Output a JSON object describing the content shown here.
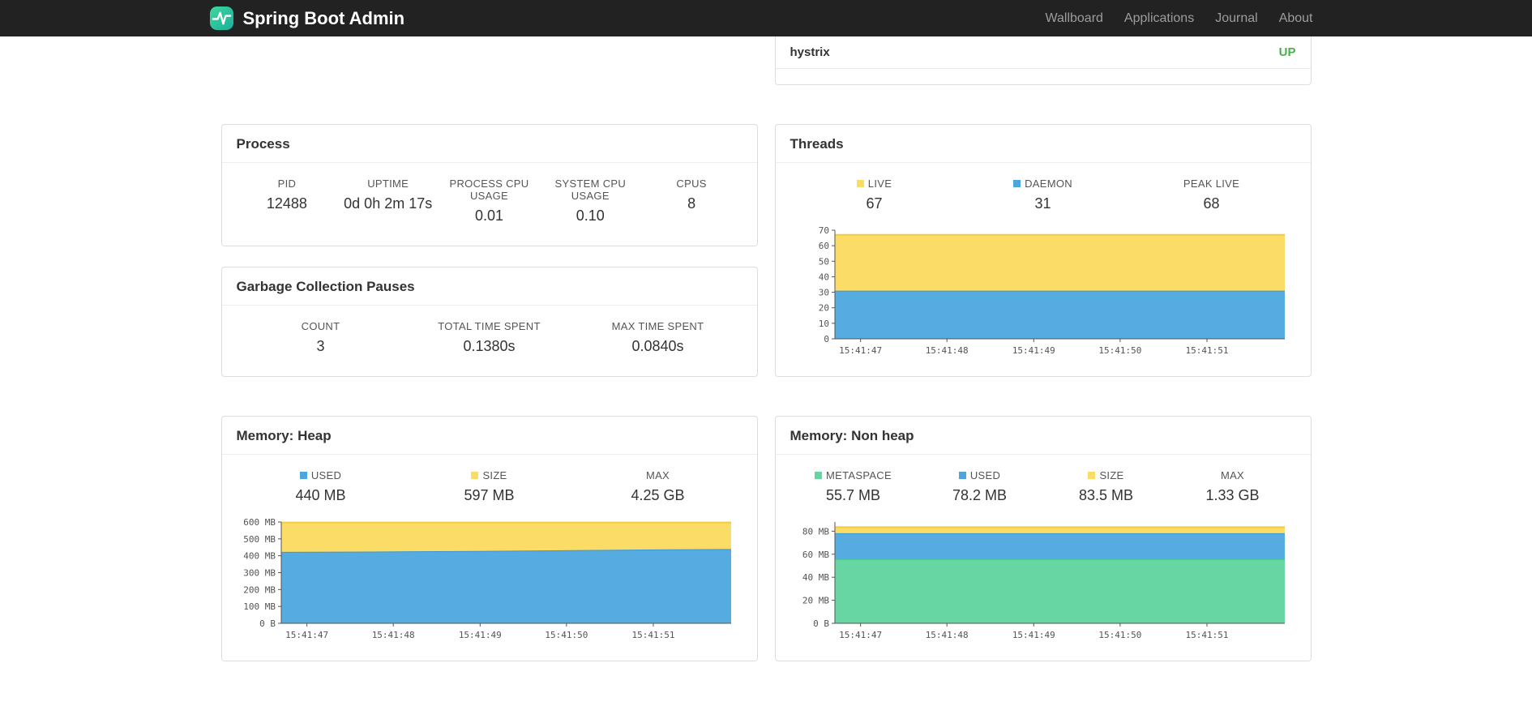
{
  "navbar": {
    "brand": "Spring Boot Admin",
    "items": [
      {
        "label": "Wallboard"
      },
      {
        "label": "Applications"
      },
      {
        "label": "Journal"
      },
      {
        "label": "About"
      }
    ]
  },
  "applications": {
    "rows": [
      {
        "name": "hystrix",
        "status": "UP",
        "status_color": "#47B04B"
      }
    ]
  },
  "process": {
    "title": "Process",
    "stats": [
      {
        "label": "PID",
        "value": "12488"
      },
      {
        "label": "UPTIME",
        "value": "0d 0h 2m 17s"
      },
      {
        "label": "PROCESS CPU USAGE",
        "value": "0.01"
      },
      {
        "label": "SYSTEM CPU USAGE",
        "value": "0.10"
      },
      {
        "label": "CPUS",
        "value": "8"
      }
    ]
  },
  "gc": {
    "title": "Garbage Collection Pauses",
    "stats": [
      {
        "label": "COUNT",
        "value": "3"
      },
      {
        "label": "TOTAL TIME SPENT",
        "value": "0.1380s"
      },
      {
        "label": "MAX TIME SPENT",
        "value": "0.0840s"
      }
    ]
  },
  "threads": {
    "title": "Threads",
    "stats": [
      {
        "label": "LIVE",
        "value": "67",
        "swatch": "#FBDC66"
      },
      {
        "label": "DAEMON",
        "value": "31",
        "swatch": "#4DA5DC"
      },
      {
        "label": "PEAK LIVE",
        "value": "68"
      }
    ]
  },
  "heap": {
    "title": "Memory: Heap",
    "stats": [
      {
        "label": "USED",
        "value": "440 MB",
        "swatch": "#4DA5DC"
      },
      {
        "label": "SIZE",
        "value": "597 MB",
        "swatch": "#FBDC66"
      },
      {
        "label": "MAX",
        "value": "4.25 GB"
      }
    ]
  },
  "nonheap": {
    "title": "Memory: Non heap",
    "stats": [
      {
        "label": "METASPACE",
        "value": "55.7 MB",
        "swatch": "#63D5A0"
      },
      {
        "label": "USED",
        "value": "78.2 MB",
        "swatch": "#4DA5DC"
      },
      {
        "label": "SIZE",
        "value": "83.5 MB",
        "swatch": "#FBDC66"
      },
      {
        "label": "MAX",
        "value": "1.33 GB"
      }
    ]
  },
  "chart_data": [
    {
      "id": "threads",
      "type": "area",
      "stacked": true,
      "title": "Threads",
      "ymax": 70,
      "yticks": [
        {
          "v": 0,
          "label": "0"
        },
        {
          "v": 10,
          "label": "10"
        },
        {
          "v": 20,
          "label": "20"
        },
        {
          "v": 30,
          "label": "30"
        },
        {
          "v": 40,
          "label": "40"
        },
        {
          "v": 50,
          "label": "50"
        },
        {
          "v": 60,
          "label": "60"
        },
        {
          "v": 70,
          "label": "70"
        }
      ],
      "xticks": [
        {
          "f": 0.057,
          "label": "15:41:47"
        },
        {
          "f": 0.249,
          "label": "15:41:48"
        },
        {
          "f": 0.442,
          "label": "15:41:49"
        },
        {
          "f": 0.634,
          "label": "15:41:50"
        },
        {
          "f": 0.827,
          "label": "15:41:51"
        }
      ],
      "series": [
        {
          "name": "DAEMON",
          "fill": "#56ACE0",
          "stroke": "#3E97D3",
          "tops": [
            31,
            31,
            31,
            31,
            31,
            31
          ]
        },
        {
          "name": "LIVE",
          "fill": "#FBDC66",
          "stroke": "#F3CB3D",
          "tops": [
            67,
            67,
            67,
            67,
            67,
            67
          ]
        }
      ]
    },
    {
      "id": "memory-heap",
      "type": "area",
      "stacked": true,
      "title": "Memory: Heap",
      "ymax": 600,
      "yticks": [
        {
          "v": 0,
          "label": "0 B"
        },
        {
          "v": 100,
          "label": "100 MB"
        },
        {
          "v": 200,
          "label": "200 MB"
        },
        {
          "v": 300,
          "label": "300 MB"
        },
        {
          "v": 400,
          "label": "400 MB"
        },
        {
          "v": 500,
          "label": "500 MB"
        },
        {
          "v": 600,
          "label": "600 MB"
        }
      ],
      "xticks": [
        {
          "f": 0.057,
          "label": "15:41:47"
        },
        {
          "f": 0.249,
          "label": "15:41:48"
        },
        {
          "f": 0.442,
          "label": "15:41:49"
        },
        {
          "f": 0.634,
          "label": "15:41:50"
        },
        {
          "f": 0.827,
          "label": "15:41:51"
        }
      ],
      "series": [
        {
          "name": "USED",
          "fill": "#56ACE0",
          "stroke": "#3E97D3",
          "tops": [
            423,
            425,
            428,
            432,
            437,
            440
          ]
        },
        {
          "name": "SIZE",
          "fill": "#FBDC66",
          "stroke": "#F3CB3D",
          "tops": [
            597,
            597,
            597,
            597,
            597,
            597
          ]
        }
      ]
    },
    {
      "id": "memory-nonheap",
      "type": "area",
      "stacked": true,
      "title": "Memory: Non heap",
      "ymax": 88,
      "yticks": [
        {
          "v": 0,
          "label": "0 B"
        },
        {
          "v": 20,
          "label": "20 MB"
        },
        {
          "v": 40,
          "label": "40 MB"
        },
        {
          "v": 60,
          "label": "60 MB"
        },
        {
          "v": 80,
          "label": "80 MB"
        }
      ],
      "xticks": [
        {
          "f": 0.057,
          "label": "15:41:47"
        },
        {
          "f": 0.249,
          "label": "15:41:48"
        },
        {
          "f": 0.442,
          "label": "15:41:49"
        },
        {
          "f": 0.634,
          "label": "15:41:50"
        },
        {
          "f": 0.827,
          "label": "15:41:51"
        }
      ],
      "series": [
        {
          "name": "METASPACE",
          "fill": "#68D6A2",
          "stroke": "#43C98C",
          "tops": [
            55.7,
            55.7,
            55.7,
            55.7,
            55.7,
            55.7
          ]
        },
        {
          "name": "USED",
          "fill": "#56ACE0",
          "stroke": "#3E97D3",
          "tops": [
            78.2,
            78.2,
            78.2,
            78.2,
            78.2,
            78.2
          ]
        },
        {
          "name": "SIZE",
          "fill": "#FBDC66",
          "stroke": "#F3CB3D",
          "tops": [
            83.5,
            83.5,
            83.5,
            83.5,
            83.5,
            83.5
          ]
        }
      ]
    }
  ]
}
